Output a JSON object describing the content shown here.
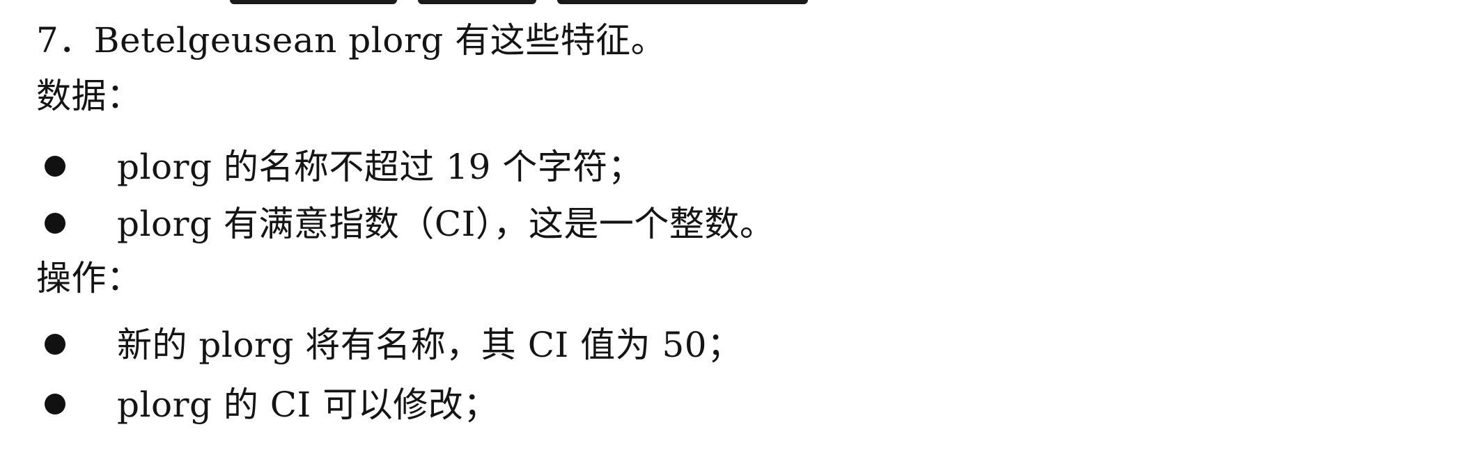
{
  "problem": {
    "title": "7．Betelgeusean plorg 有这些特征。",
    "data_heading": "数据：",
    "data_items": [
      "plorg 的名称不超过 19 个字符；",
      "plorg 有满意指数（CI），这是一个整数。"
    ],
    "ops_heading": "操作：",
    "ops_items": [
      "新的 plorg 将有名称，其 CI 值为 50；",
      "plorg 的 CI 可以修改；"
    ]
  }
}
